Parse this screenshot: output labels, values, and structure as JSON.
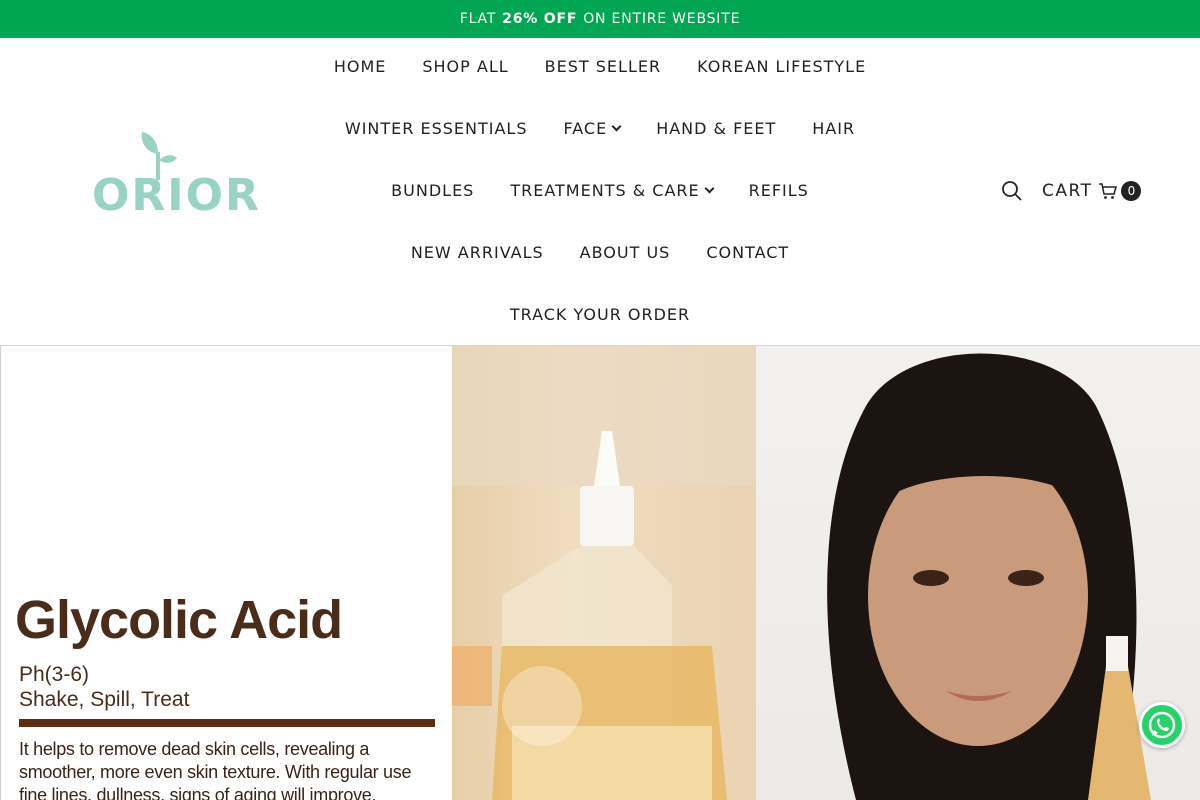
{
  "announcement": {
    "prefix": "FLAT",
    "highlight": "26% OFF",
    "suffix": "ON ENTIRE WEBSITE"
  },
  "brand": {
    "logo_text": "ORIOR",
    "color": "#98d3c3"
  },
  "colors": {
    "announcement_bg": "#00a651",
    "product_text": "#4a2c1b"
  },
  "nav": {
    "row1": [
      "HOME",
      "SHOP ALL",
      "BEST SELLER",
      "KOREAN LIFESTYLE"
    ],
    "row2": [
      "WINTER ESSENTIALS",
      "FACE",
      "HAND & FEET",
      "HAIR"
    ],
    "row3": [
      "BUNDLES",
      "TREATMENTS & CARE",
      "REFILS"
    ],
    "row4": [
      "NEW ARRIVALS",
      "ABOUT US",
      "CONTACT"
    ],
    "row5": [
      "TRACK YOUR ORDER"
    ]
  },
  "header_actions": {
    "search_icon": "search-icon",
    "cart_label": "CART",
    "cart_icon": "cart-icon",
    "cart_count": "0"
  },
  "hero": {
    "product_title": "Glycolic Acid",
    "ph": "Ph(3-6)",
    "tagline": "Shake, Spill, Treat",
    "description": "It helps to remove dead skin cells, revealing a smoother, more even skin texture. With regular use fine lines, dullness, signs of aging will improve."
  },
  "floating": {
    "whatsapp_icon": "whatsapp-icon"
  }
}
